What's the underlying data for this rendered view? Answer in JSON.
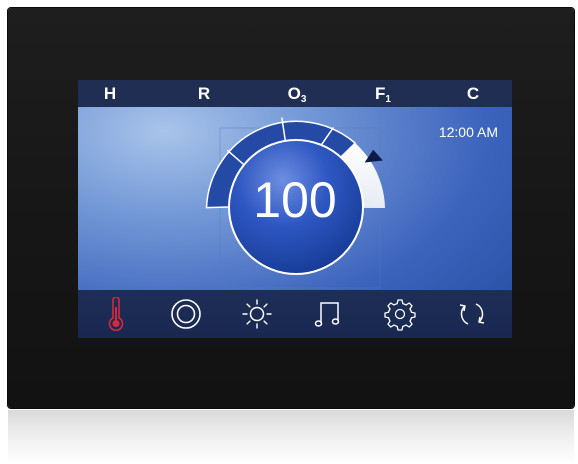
{
  "top_tabs": [
    {
      "main": "H",
      "sub": ""
    },
    {
      "main": "R",
      "sub": ""
    },
    {
      "main": "O",
      "sub": "3"
    },
    {
      "main": "F",
      "sub": "1"
    },
    {
      "main": "C",
      "sub": ""
    }
  ],
  "clock": "12:00 AM",
  "setpoint": "100",
  "bottom_icons": [
    {
      "name": "thermometer-icon",
      "color": "#d6283b"
    },
    {
      "name": "jets-icon",
      "color": "#ffffff"
    },
    {
      "name": "light-icon",
      "color": "#ffffff"
    },
    {
      "name": "music-icon",
      "color": "#ffffff"
    },
    {
      "name": "settings-gear-icon",
      "color": "#ffffff"
    },
    {
      "name": "cycle-arrows-icon",
      "color": "#ffffff"
    }
  ],
  "colors": {
    "gauge_arc": "#244aa6",
    "gauge_track": "#ffffff",
    "active_icon": "#d6283b"
  }
}
